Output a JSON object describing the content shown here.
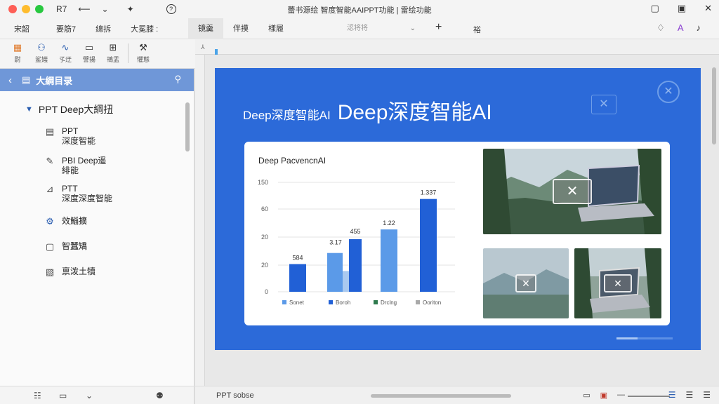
{
  "window": {
    "title": "蕾书源绘 智度智能AAIPPT功能 | 雷绘功能",
    "left_icons": [
      "R7",
      "⟵",
      "⌄",
      "✦"
    ],
    "help_icon": "?",
    "controls": [
      "▢",
      "▣",
      "✕"
    ]
  },
  "menubar": {
    "items": [
      "宋韶",
      "要筋7",
      "總拆",
      "大冕膝 :"
    ],
    "tabs": [
      "镜羹",
      "伴摸",
      "樣履"
    ],
    "active_tab": 0,
    "select_value": "涊将将",
    "plus": "+",
    "misc": "裕",
    "right_icons": [
      "♢",
      "A",
      "♪"
    ]
  },
  "toolbar": {
    "tools": [
      {
        "icon": "layers-icon",
        "glyph": "▦",
        "label": "尉"
      },
      {
        "icon": "user-icon",
        "glyph": "⚇",
        "label": "鲨媸"
      },
      {
        "icon": "wave-icon",
        "glyph": "∿",
        "label": "孓迂"
      },
      {
        "icon": "monitor-icon",
        "glyph": "▭",
        "label": "譬揚"
      },
      {
        "icon": "grid-icon",
        "glyph": "⊞",
        "label": "鳵盂"
      },
      {
        "icon": "hammer-icon",
        "glyph": "⚒",
        "label": "懼態"
      }
    ]
  },
  "sidebar": {
    "header_title": "大綱目录",
    "root_label": "PPT Deep大綱扭",
    "items": [
      {
        "icon": "document-icon",
        "glyph": "▤",
        "lines": [
          "PPT",
          "深度智能"
        ]
      },
      {
        "icon": "edit-icon",
        "glyph": "✎",
        "lines": [
          "PBI Deep遥",
          "緋能"
        ]
      },
      {
        "icon": "chart-icon",
        "glyph": "⊿",
        "lines": [
          "PTT",
          "深度深度智能"
        ]
      },
      {
        "icon": "gear-icon",
        "glyph": "⚙",
        "lines": [
          "效鯔擴"
        ]
      },
      {
        "icon": "clipboard-icon",
        "glyph": "▢",
        "lines": [
          "智蠶矯"
        ]
      },
      {
        "icon": "file-icon",
        "glyph": "▧",
        "lines": [
          "禀泼土犢"
        ]
      }
    ],
    "bottom_icons": [
      "☷",
      "▭",
      "⌄",
      "⚉"
    ]
  },
  "slide": {
    "title_small": "Deep深度智能AI",
    "title_big": "Deep深度智能AI",
    "placeholder_icon": "✕"
  },
  "chart_data": {
    "type": "bar",
    "title": "Deep PacvencnAI",
    "y_ticks": [
      "0",
      "20",
      "20",
      "60",
      "150"
    ],
    "groups": [
      {
        "bars": [
          {
            "value": 20,
            "color": "#2160d6"
          }
        ],
        "label": "584"
      },
      {
        "bars": [
          {
            "value": 28,
            "color": "#5b9ae8"
          },
          {
            "value": 15,
            "color": "#a9c9f0"
          },
          {
            "value": 38,
            "color": "#2160d6"
          }
        ],
        "labels": [
          "3.17",
          "455"
        ]
      },
      {
        "bars": [
          {
            "value": 45,
            "color": "#5b9ae8"
          }
        ],
        "label": "1.22"
      },
      {
        "bars": [
          {
            "value": 67,
            "color": "#2160d6"
          }
        ],
        "label": "1.337"
      }
    ],
    "legend": [
      {
        "name": "Sonet",
        "color": "#5b9ae8"
      },
      {
        "name": "Boroh",
        "color": "#2160d6"
      },
      {
        "name": "Drclng",
        "color": "#2f7a4e"
      },
      {
        "name": "Ooriton",
        "color": "#a9a9a9"
      }
    ]
  },
  "statusbar": {
    "text": "PPT sobse",
    "icons": [
      "▭",
      "▣",
      "—"
    ],
    "right_icons": [
      "☰",
      "☰",
      "☰"
    ]
  }
}
